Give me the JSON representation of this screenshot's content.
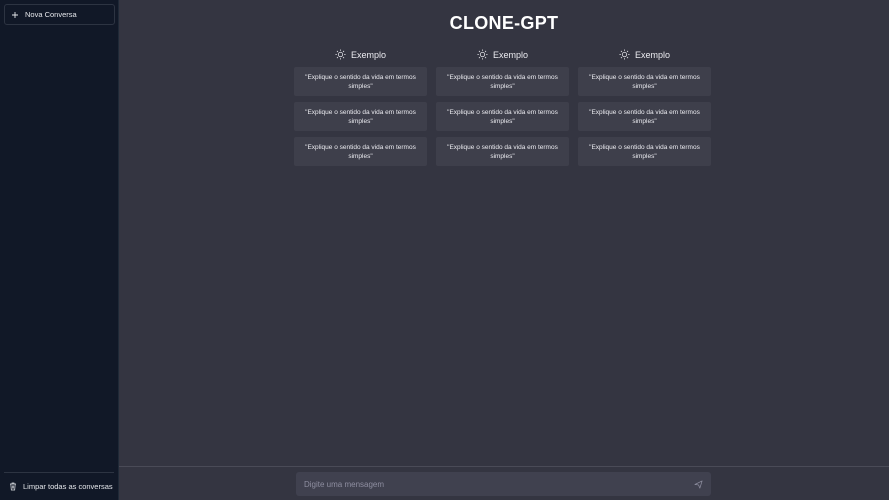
{
  "sidebar": {
    "new_chat_label": "Nova Conversa",
    "clear_label": "Limpar todas as conversas"
  },
  "main": {
    "title": "CLONE-GPT",
    "columns": [
      {
        "header": "Exemplo",
        "icon": "sun-icon",
        "cards": [
          "\"Explique o sentido da vida em termos simples\"",
          "\"Explique o sentido da vida em termos simples\"",
          "\"Explique o sentido da vida em termos simples\""
        ]
      },
      {
        "header": "Exemplo",
        "icon": "sun-icon",
        "cards": [
          "\"Explique o sentido da vida em termos simples\"",
          "\"Explique o sentido da vida em termos simples\"",
          "\"Explique o sentido da vida em termos simples\""
        ]
      },
      {
        "header": "Exemplo",
        "icon": "sun-icon",
        "cards": [
          "\"Explique o sentido da vida em termos simples\"",
          "\"Explique o sentido da vida em termos simples\"",
          "\"Explique o sentido da vida em termos simples\""
        ]
      }
    ]
  },
  "composer": {
    "placeholder": "Digite uma mensagem",
    "value": ""
  },
  "colors": {
    "sidebar_bg": "#111827",
    "main_bg": "#343541",
    "card_bg": "#3e3f4b",
    "input_bg": "#40414f"
  }
}
